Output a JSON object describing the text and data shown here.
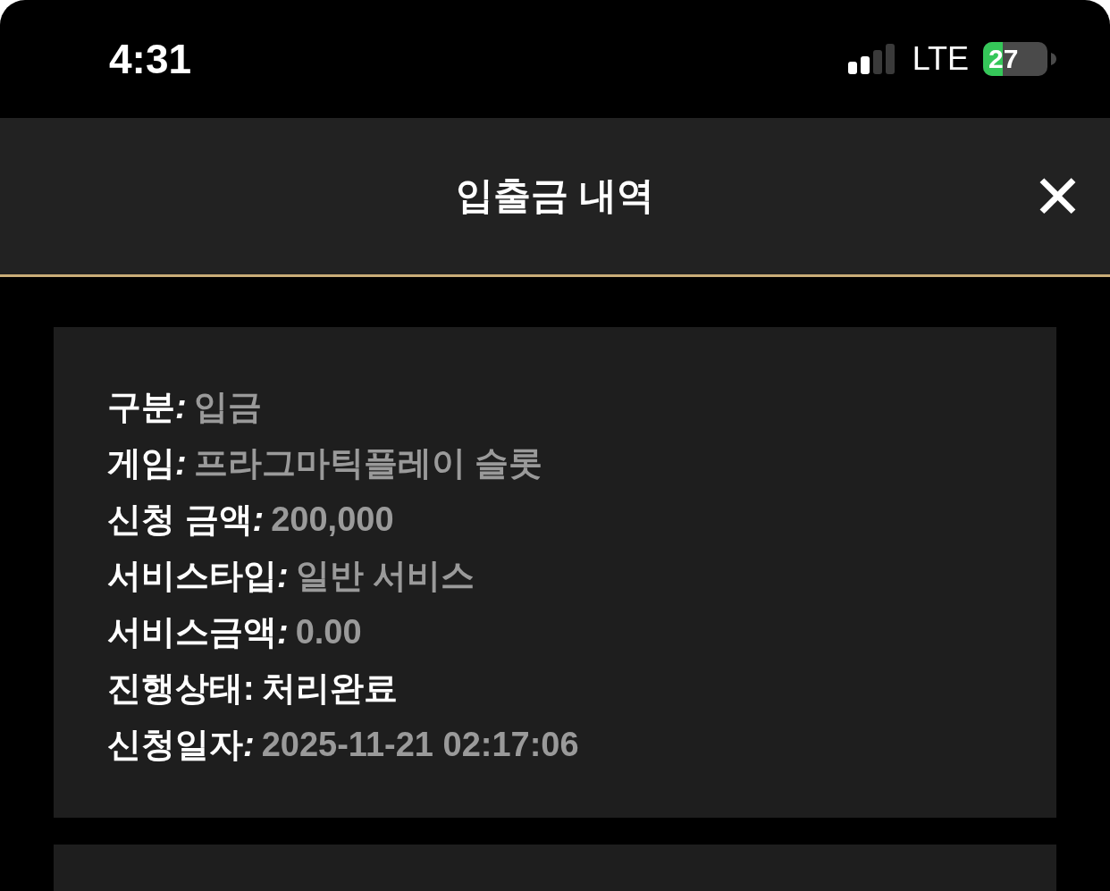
{
  "status_bar": {
    "time": "4:31",
    "network": "LTE",
    "battery": "27"
  },
  "header": {
    "title": "입출금 내역",
    "close": "✕"
  },
  "records": [
    {
      "fields": [
        {
          "label": "구분",
          "separator": ":",
          "value": "입금",
          "kind": "detail"
        },
        {
          "label": "게임",
          "separator": ":",
          "value": "프라그마틱플레이 슬롯",
          "kind": "detail"
        },
        {
          "label": "신청 금액",
          "separator": ":",
          "value": "200,000",
          "kind": "detail"
        },
        {
          "label": "서비스타입",
          "separator": ":",
          "value": "일반 서비스",
          "kind": "detail"
        },
        {
          "label": "서비스금액",
          "separator": ":",
          "value": "0.00",
          "kind": "detail"
        },
        {
          "label": "진행상태",
          "separator": ":",
          "value": "처리완료",
          "kind": "status"
        },
        {
          "label": "신청일자",
          "separator": ":",
          "value": "2025-11-21 02:17:06",
          "kind": "detail"
        }
      ]
    }
  ],
  "next_record_peek": true
}
